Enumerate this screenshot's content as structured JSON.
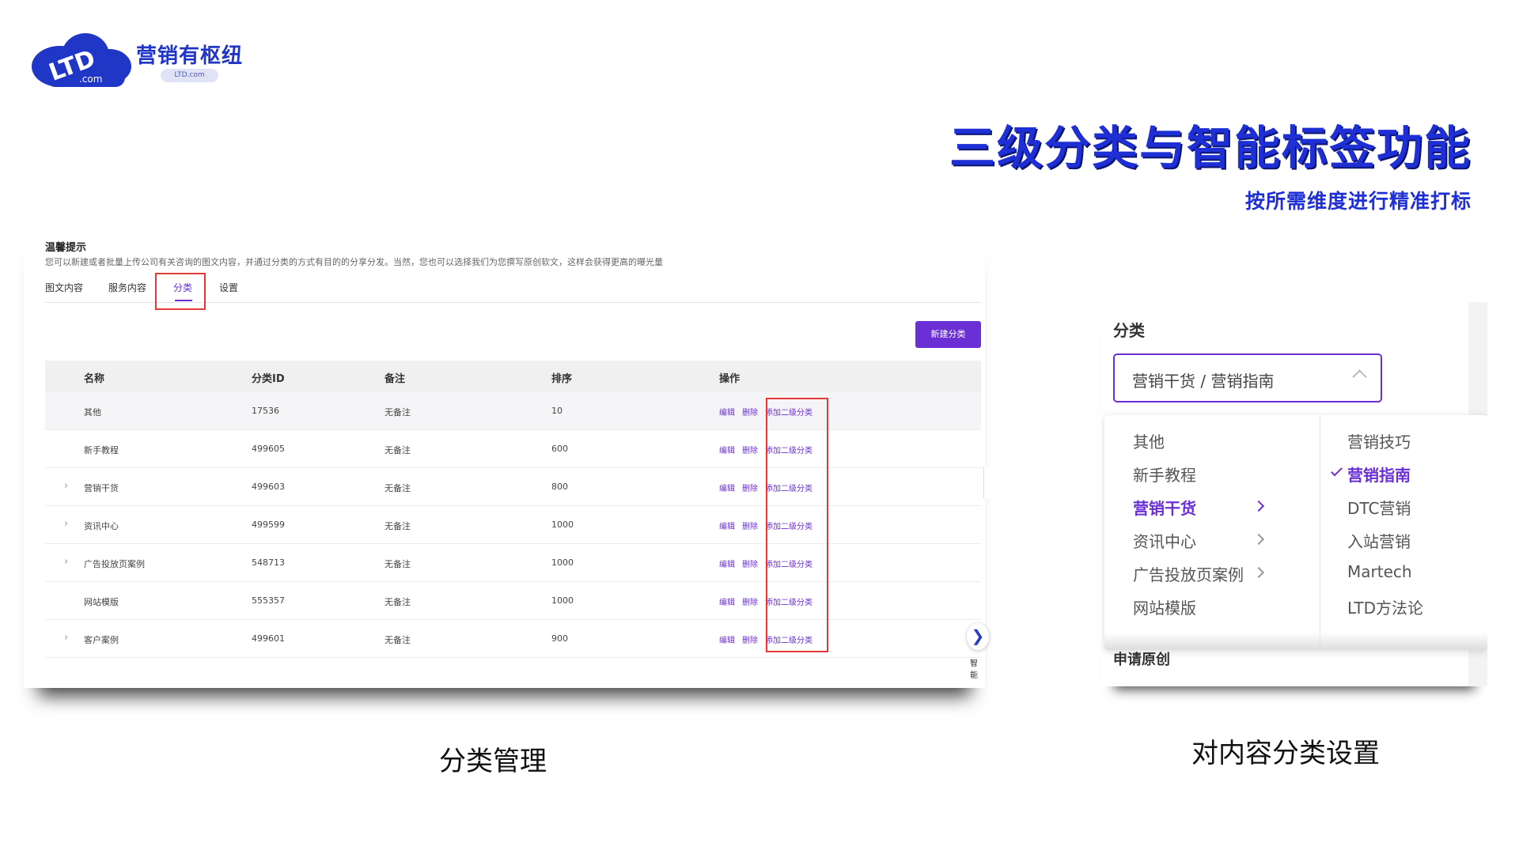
{
  "logo": {
    "mark": "LTD .com",
    "brand": "营销有枢纽",
    "domain": "LTD.com"
  },
  "headline": "三级分类与智能标签功能",
  "subheadline": "按所需维度进行精准打标",
  "left": {
    "tip_title": "温馨提示",
    "tip_text": "您可以新建或者批量上传公司有关咨询的图文内容，并通过分类的方式有目的的分享分发。当然，您也可以选择我们为您撰写原创软文，这样会获得更高的曝光量",
    "tabs": [
      "图文内容",
      "服务内容",
      "分类",
      "设置"
    ],
    "active_tab": "分类",
    "new_button": "新建分类",
    "headers": [
      "名称",
      "分类ID",
      "备注",
      "排序",
      "操作"
    ],
    "rows": [
      {
        "name": "其他",
        "id": "17536",
        "note": "无备注",
        "sort": "10",
        "expandable": false
      },
      {
        "name": "新手教程",
        "id": "499605",
        "note": "无备注",
        "sort": "600",
        "expandable": false
      },
      {
        "name": "营销干货",
        "id": "499603",
        "note": "无备注",
        "sort": "800",
        "expandable": true
      },
      {
        "name": "资讯中心",
        "id": "499599",
        "note": "无备注",
        "sort": "1000",
        "expandable": true
      },
      {
        "name": "广告投放页案例",
        "id": "548713",
        "note": "无备注",
        "sort": "1000",
        "expandable": true
      },
      {
        "name": "网站模版",
        "id": "555357",
        "note": "无备注",
        "sort": "1000",
        "expandable": false
      },
      {
        "name": "客户案例",
        "id": "499601",
        "note": "无备注",
        "sort": "900",
        "expandable": true
      }
    ],
    "ops": {
      "edit": "编辑",
      "delete": "删除",
      "add_sub": "添加二级分类"
    },
    "side_label": "智能",
    "caption": "分类管理"
  },
  "right": {
    "label": "分类",
    "select_value": "营销干货 / 营销指南",
    "col1": [
      "其他",
      "新手教程",
      "营销干货",
      "资讯中心",
      "广告投放页案例",
      "网站模版"
    ],
    "col1_selected": "营销干货",
    "col2": [
      "营销技巧",
      "营销指南",
      "DTC营销",
      "入站营销",
      "Martech",
      "LTD方法论"
    ],
    "col2_selected": "营销指南",
    "below_label": "申请原创",
    "caption": "对内容分类设置"
  },
  "colors": {
    "accent": "#6b2fd6",
    "brand_blue": "#1e2fd6",
    "highlight_border": "#e53935"
  }
}
